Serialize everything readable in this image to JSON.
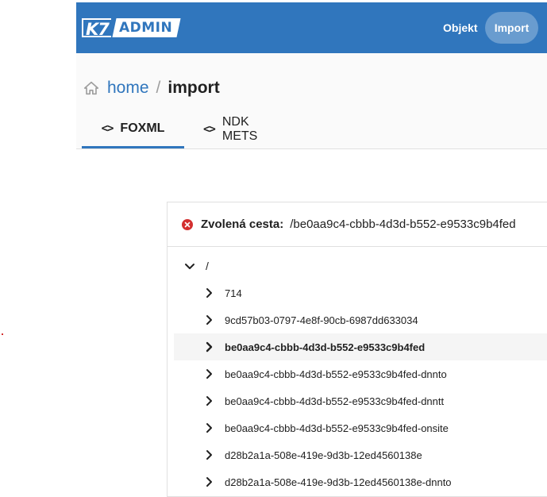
{
  "app": {
    "logo_k7": "K7",
    "logo_admin": "ADMIN"
  },
  "nav": {
    "objekt": "Objekt",
    "import": "Import"
  },
  "breadcrumb": {
    "home": "home",
    "separator": "/",
    "current": "import"
  },
  "tabs": [
    {
      "icon": "code-icon",
      "label": "FOXML",
      "active": true
    },
    {
      "icon": "code-icon",
      "label": "NDK METS",
      "active": false
    }
  ],
  "panel": {
    "path_label": "Zvolená cesta:",
    "path_value": "/be0aa9c4-cbbb-4d3d-b552-e9533c9b4fed",
    "status_icon": "error-icon",
    "status_color": "#d32f2f"
  },
  "tree": {
    "root": "/",
    "items": [
      {
        "label": "714",
        "selected": false
      },
      {
        "label": "9cd57b03-0797-4e8f-90cb-6987dd633034",
        "selected": false
      },
      {
        "label": "be0aa9c4-cbbb-4d3d-b552-e9533c9b4fed",
        "selected": true
      },
      {
        "label": "be0aa9c4-cbbb-4d3d-b552-e9533c9b4fed-dnnto",
        "selected": false
      },
      {
        "label": "be0aa9c4-cbbb-4d3d-b552-e9533c9b4fed-dnntt",
        "selected": false
      },
      {
        "label": "be0aa9c4-cbbb-4d3d-b552-e9533c9b4fed-onsite",
        "selected": false
      },
      {
        "label": "d28b2a1a-508e-419e-9d3b-12ed4560138e",
        "selected": false
      },
      {
        "label": "d28b2a1a-508e-419e-9d3b-12ed4560138e-dnnto",
        "selected": false
      }
    ]
  },
  "colors": {
    "brand": "#3076bd",
    "error": "#d32f2f"
  }
}
